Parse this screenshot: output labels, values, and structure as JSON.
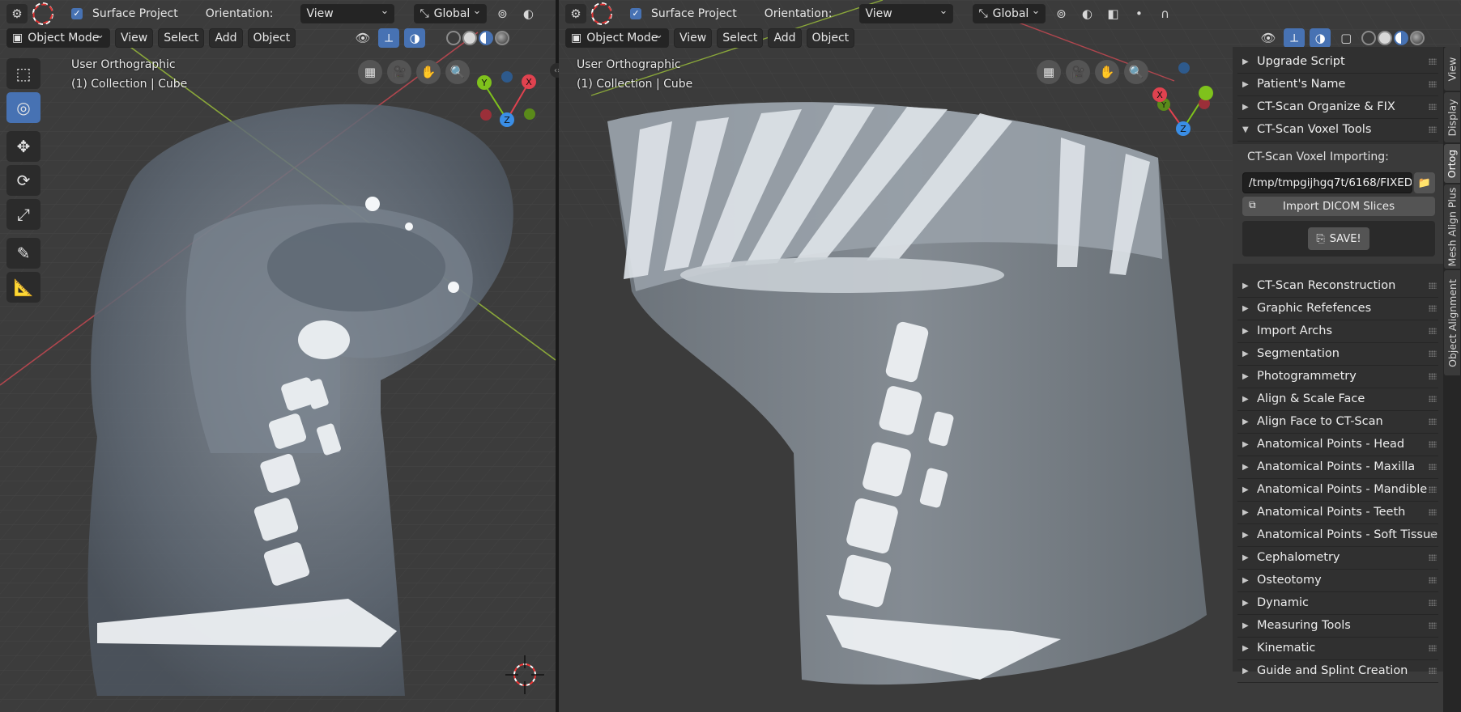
{
  "left_view": {
    "header": {
      "surface_project_label": "Surface Project",
      "orientation_label": "Orientation:",
      "orientation_value": "View",
      "transform_value": "Global",
      "mode_value": "Object Mode",
      "menu": [
        "View",
        "Select",
        "Add",
        "Object"
      ]
    },
    "info_view": "User Orthographic",
    "info_collection": "(1) Collection | Cube"
  },
  "right_view": {
    "header": {
      "surface_project_label": "Surface Project",
      "orientation_label": "Orientation:",
      "orientation_value": "View",
      "transform_value": "Global",
      "mode_value": "Object Mode",
      "menu": [
        "View",
        "Select",
        "Add",
        "Object"
      ]
    },
    "info_view": "User Orthographic",
    "info_collection": "(1) Collection | Cube"
  },
  "gizmo_axes": [
    "X",
    "Y",
    "Z"
  ],
  "sidebar": {
    "items_top": [
      {
        "label": "Upgrade Script",
        "arrow": "▶"
      },
      {
        "label": "Patient's Name",
        "arrow": "▶"
      },
      {
        "label": "CT-Scan Organize & FIX",
        "arrow": "▶"
      },
      {
        "label": "CT-Scan Voxel Tools",
        "arrow": "▼"
      }
    ],
    "voxel_panel": {
      "subtitle": "CT-Scan Voxel Importing:",
      "path_value": "/tmp/tmpgijhgq7t/6168/FIXED/",
      "import_label": "Import DICOM Slices",
      "save_label": "SAVE!"
    },
    "items_bottom": [
      {
        "label": "CT-Scan Reconstruction",
        "arrow": "▶"
      },
      {
        "label": "Graphic Refefences",
        "arrow": "▶"
      },
      {
        "label": "Import Archs",
        "arrow": "▶"
      },
      {
        "label": "Segmentation",
        "arrow": "▶"
      },
      {
        "label": "Photogrammetry",
        "arrow": "▶"
      },
      {
        "label": "Align & Scale Face",
        "arrow": "▶"
      },
      {
        "label": "Align Face to CT-Scan",
        "arrow": "▶"
      },
      {
        "label": "Anatomical Points - Head",
        "arrow": "▶"
      },
      {
        "label": "Anatomical Points - Maxilla",
        "arrow": "▶"
      },
      {
        "label": "Anatomical Points - Mandible",
        "arrow": "▶"
      },
      {
        "label": "Anatomical Points - Teeth",
        "arrow": "▶"
      },
      {
        "label": "Anatomical Points - Soft Tissue",
        "arrow": "▶"
      },
      {
        "label": "Cephalometry",
        "arrow": "▶"
      },
      {
        "label": "Osteotomy",
        "arrow": "▶"
      },
      {
        "label": "Dynamic",
        "arrow": "▶"
      },
      {
        "label": "Measuring Tools",
        "arrow": "▶"
      },
      {
        "label": "Kinematic",
        "arrow": "▶"
      },
      {
        "label": "Guide and Splint Creation",
        "arrow": "▶"
      }
    ]
  },
  "tabs": [
    {
      "label": "View"
    },
    {
      "label": "Display"
    },
    {
      "label": "Ortog",
      "active": true
    },
    {
      "label": "Mesh Align Plus"
    },
    {
      "label": "Object Alignment"
    }
  ],
  "colors": {
    "accent": "#4772b3",
    "axis_x": "#e0424f",
    "axis_y": "#7fc21c",
    "axis_z": "#3a8ee6",
    "viewport": "#3b3b3b"
  }
}
